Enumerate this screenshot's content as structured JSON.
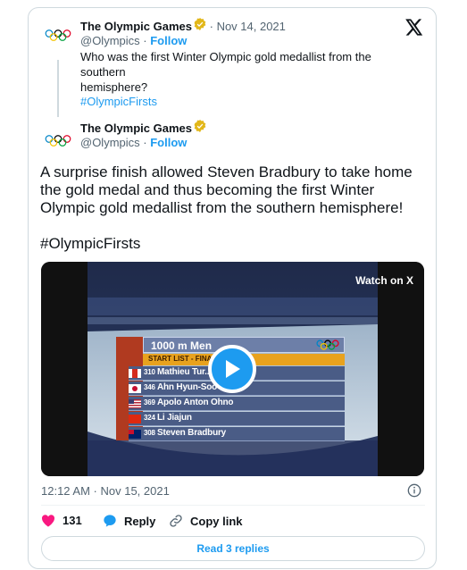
{
  "tweet_reply_parent": {
    "author_name": "The Olympic Games",
    "handle": "@Olympics",
    "follow_label": "Follow",
    "separator": " · ",
    "date": "Nov 14, 2021",
    "text_line1": "Who was the first Winter Olympic gold medallist from the southern",
    "text_line2": "hemisphere?",
    "hashtag": "#OlympicFirsts"
  },
  "tweet_main": {
    "author_name": "The Olympic Games",
    "handle": "@Olympics",
    "follow_label": "Follow",
    "separator": " · ",
    "text_line1": "A surprise finish allowed Steven Bradbury to take home",
    "text_line2": "the gold medal and thus becoming the first Winter",
    "text_line3": "Olympic gold medallist from the southern hemisphere!",
    "hashtag": "#OlympicFirsts"
  },
  "video": {
    "watch_label": "Watch on X",
    "event_title": "1000 m Men",
    "start_list_label": "START LIST - FINAL A",
    "competitors": [
      {
        "num": "310",
        "name": "Mathieu Tur..."
      },
      {
        "num": "346",
        "name": "Ahn Hyun-Soo"
      },
      {
        "num": "369",
        "name": "Apolo Anton Ohno"
      },
      {
        "num": "324",
        "name": "Li Jiajun"
      },
      {
        "num": "308",
        "name": "Steven Bradbury"
      }
    ]
  },
  "meta": {
    "timestamp": "12:12 AM · Nov 15, 2021"
  },
  "actions": {
    "like_count": "131",
    "reply_label": "Reply",
    "copy_label": "Copy link",
    "read_replies_label": "Read 3 replies"
  },
  "colors": {
    "accent": "#1d9bf0",
    "like": "#f91880",
    "verified_gold": "#e2b719"
  }
}
